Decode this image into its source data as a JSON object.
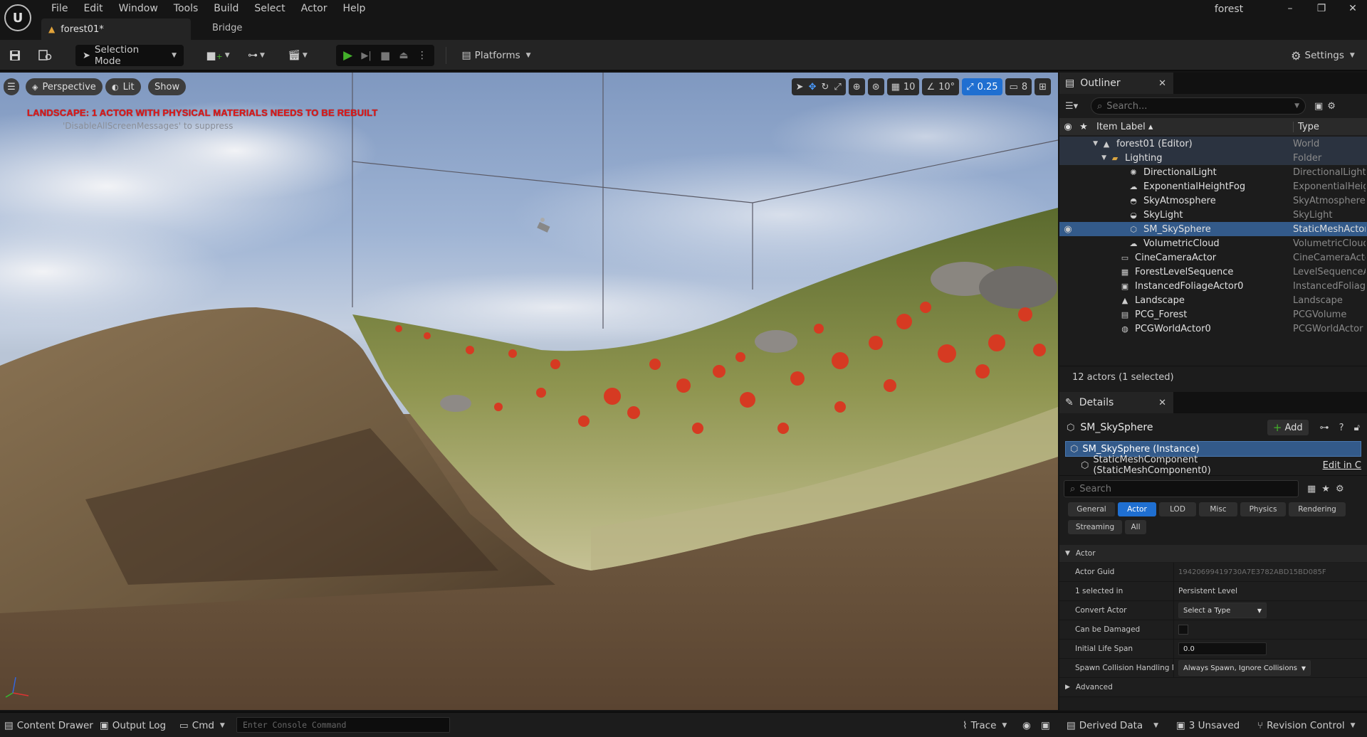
{
  "menu": [
    "File",
    "Edit",
    "Window",
    "Tools",
    "Build",
    "Select",
    "Actor",
    "Help"
  ],
  "tabs": {
    "document": "forest01*",
    "bridge": "Bridge"
  },
  "project_name": "forest",
  "toolbar": {
    "selection_mode": "Selection Mode",
    "platforms": "Platforms",
    "settings": "Settings"
  },
  "viewport": {
    "perspective": "Perspective",
    "lit": "Lit",
    "show": "Show",
    "warning": "LANDSCAPE: 1 ACTOR WITH PHYSICAL MATERIALS NEEDS TO BE REBUILT",
    "suppress": "'DisableAllScreenMessages' to suppress",
    "grid_snap": "10",
    "rot_snap": "10°",
    "scale_snap": "0.25",
    "cam_speed": "8"
  },
  "outliner": {
    "tab": "Outliner",
    "search_placeholder": "Search...",
    "col_label": "Item Label ▴",
    "col_type": "Type",
    "items": [
      {
        "label": "forest01 (Editor)",
        "type": "World"
      },
      {
        "label": "Lighting",
        "type": "Folder"
      },
      {
        "label": "DirectionalLight",
        "type": "DirectionalLight"
      },
      {
        "label": "ExponentialHeightFog",
        "type": "ExponentialHeig"
      },
      {
        "label": "SkyAtmosphere",
        "type": "SkyAtmosphere"
      },
      {
        "label": "SkyLight",
        "type": "SkyLight"
      },
      {
        "label": "SM_SkySphere",
        "type": "StaticMeshActor"
      },
      {
        "label": "VolumetricCloud",
        "type": "VolumetricCloud"
      },
      {
        "label": "CineCameraActor",
        "type": "CineCameraActo"
      },
      {
        "label": "ForestLevelSequence",
        "type": "LevelSequenceA"
      },
      {
        "label": "InstancedFoliageActor0",
        "type": "InstancedFoliage"
      },
      {
        "label": "Landscape",
        "type": "Landscape"
      },
      {
        "label": "PCG_Forest",
        "type": "PCGVolume"
      },
      {
        "label": "PCGWorldActor0",
        "type": "PCGWorldActor"
      }
    ],
    "count": "12 actors (1 selected)"
  },
  "details": {
    "tab": "Details",
    "actor": "SM_SkySphere",
    "add": "Add",
    "instance": "SM_SkySphere (Instance)",
    "component": "StaticMeshComponent (StaticMeshComponent0)",
    "edit_in": "Edit in C",
    "search_placeholder": "Search",
    "filters": [
      "General",
      "Actor",
      "LOD",
      "Misc",
      "Physics",
      "Rendering",
      "Streaming",
      "All"
    ],
    "section": "Actor",
    "props": {
      "guid_label": "Actor Guid",
      "guid_value": "19420699419730A7E3782ABD15BD085F",
      "selected_label": "1 selected in",
      "selected_value": "Persistent Level",
      "convert_label": "Convert Actor",
      "convert_value": "Select a Type",
      "damaged_label": "Can be Damaged",
      "lifespan_label": "Initial Life Span",
      "lifespan_value": "0.0",
      "spawn_label": "Spawn Collision Handling M...",
      "spawn_value": "Always Spawn, Ignore Collisions"
    },
    "advanced": "Advanced"
  },
  "status": {
    "content_drawer": "Content Drawer",
    "output_log": "Output Log",
    "cmd": "Cmd",
    "console_placeholder": "Enter Console Command",
    "trace": "Trace",
    "derived_data": "Derived Data",
    "unsaved": "3 Unsaved",
    "revision": "Revision Control"
  },
  "colors": {
    "accent": "#1f6fd1",
    "selection": "#335a8a",
    "warning": "#e01818",
    "play": "#43b02a"
  }
}
